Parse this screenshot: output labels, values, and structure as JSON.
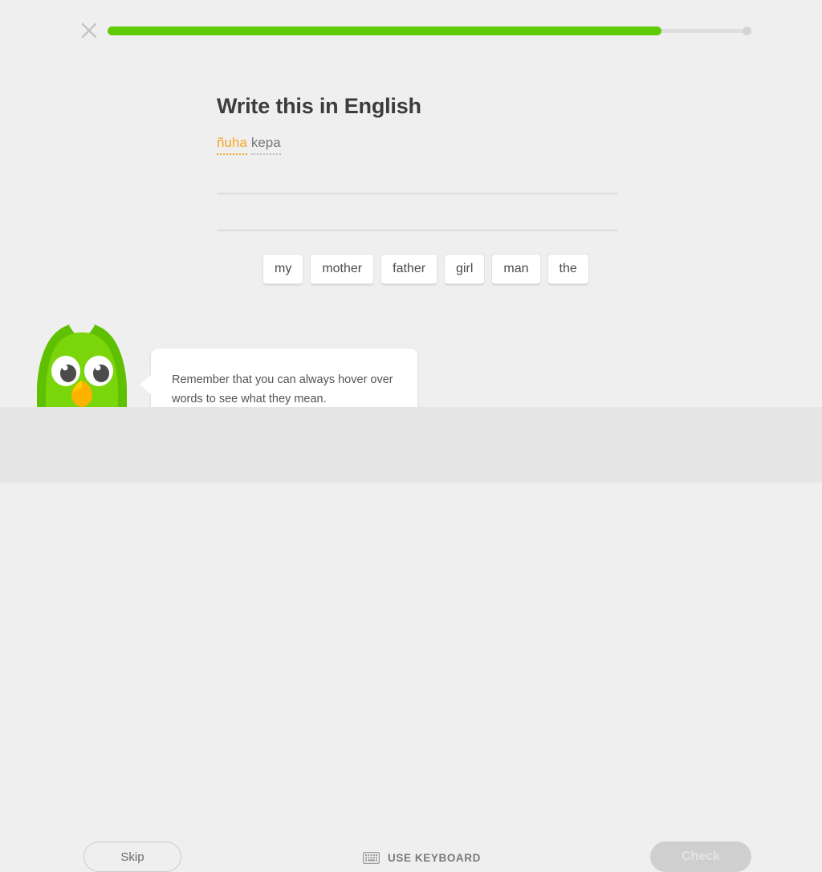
{
  "header": {
    "close_icon": "close-x-icon",
    "progress": {
      "percent": 86,
      "fill_color": "#5fcb03",
      "track_color": "#dedede",
      "endcap_color": "#d5d5d5"
    }
  },
  "exercise": {
    "title": "Write this in English",
    "prompt_words": [
      {
        "text": "ñuha",
        "style": "hinted",
        "color": "#f5a623"
      },
      {
        "text": "kepa",
        "style": "plain",
        "color": "#777777"
      }
    ],
    "answer_lines": 2,
    "word_bank": [
      {
        "label": "my"
      },
      {
        "label": "mother"
      },
      {
        "label": "father"
      },
      {
        "label": "girl"
      },
      {
        "label": "man"
      },
      {
        "label": "the"
      }
    ]
  },
  "coach": {
    "mascot": "duo-owl-mascot",
    "tip_text": "Remember that you can always hover over words to see what they mean."
  },
  "footer": {
    "skip_label": "Skip",
    "use_keyboard_label": "USE KEYBOARD",
    "keyboard_icon": "keyboard-icon",
    "check_label": "Check",
    "check_enabled": false
  },
  "theme": {
    "page_background": "#efefef",
    "footer_background": "#e5e5e5",
    "text_primary": "#3c3c3c",
    "brand_green": "#5fcb03",
    "accent_orange": "#f5a623"
  }
}
